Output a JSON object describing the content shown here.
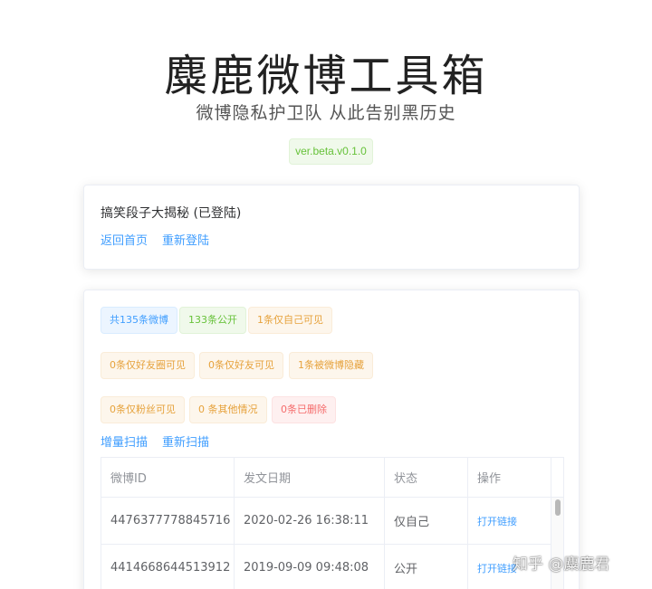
{
  "header": {
    "title": "麋鹿微博工具箱",
    "subtitle": "微博隐私护卫队 从此告别黑历史",
    "version": "ver.beta.v0.1.0"
  },
  "user_card": {
    "user_label": "搞笑段子大揭秘 (已登陆)",
    "back_home": "返回首页",
    "relogin": "重新登陆"
  },
  "stats": {
    "total": "共135条微博",
    "public": "133条公开",
    "self_only": "1条仅自己可见",
    "circle_only": "0条仅好友圈可见",
    "friends_only": "0条仅好友可见",
    "hidden": "1条被微博隐藏",
    "fans_only": "0条仅粉丝可见",
    "other": "0 条其他情况",
    "deleted": "0条已删除"
  },
  "actions": {
    "incremental_scan": "增量扫描",
    "rescan": "重新扫描"
  },
  "table": {
    "headers": [
      "微博ID",
      "发文日期",
      "状态",
      "操作"
    ],
    "rows": [
      {
        "id": "4476377778845716",
        "date": "2020-02-26 16:38:11",
        "status": "仅自己",
        "action": "打开链接"
      },
      {
        "id": "4414668644513912",
        "date": "2019-09-09 09:48:08",
        "status": "公开",
        "action": "打开链接"
      }
    ]
  },
  "watermark": "知乎 @麋鹿君",
  "colors": {
    "primary": "#409eff",
    "success": "#67c23a",
    "warning": "#e6a23c",
    "danger": "#f56c6c"
  }
}
